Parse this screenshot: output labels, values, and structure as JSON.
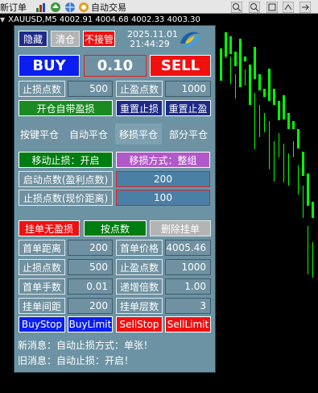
{
  "toolbar": {
    "new_order": "新订单",
    "auto_trading": "自动交易"
  },
  "chart_header": {
    "text": "XAUUSD,M5  4002.91 4004.68 4002.33 4003.30"
  },
  "panel": {
    "hide": "隐藏",
    "clear": "清仓",
    "no_take": "不接管",
    "date": "2025.11.01",
    "time": "21:44:29",
    "buy": "BUY",
    "lot": "0.10",
    "sell": "SELL",
    "sl_label": "止损点数",
    "sl_value": "500",
    "tp_label": "止盈点数",
    "tp_value": "1000",
    "open_with_sltp": "开仓自带盈损",
    "reset_sl": "重置止损",
    "reset_tp": "重置止盈",
    "tabs": [
      "按键平仓",
      "自动平仓",
      "移损平仓",
      "部分平仓"
    ],
    "trailing_stop": "移动止损：开启",
    "trailing_mode": "移损方式：整组",
    "trigger_label": "启动点数(盈利点数)",
    "trigger_value": "200",
    "stop_label": "止损点数(现价距离)",
    "stop_value": "100",
    "pending_no_sltp": "挂单无盈损",
    "by_points": "按点数",
    "delete_pending": "删除挂单",
    "first_distance_label": "首单距离",
    "first_distance_value": "200",
    "first_price_label": "首单价格",
    "first_price_value": "4005.46",
    "p_sl_label": "止损点数",
    "p_sl_value": "500",
    "p_tp_label": "止盈点数",
    "p_tp_value": "1000",
    "first_lot_label": "首单手数",
    "first_lot_value": "0.01",
    "multiplier_label": "递增倍数",
    "multiplier_value": "1.00",
    "interval_label": "挂单间距",
    "interval_value": "200",
    "layers_label": "挂单层数",
    "layers_value": "3",
    "buystop": "BuyStop",
    "buylimit": "BuyLimit",
    "sellstop": "SellStop",
    "selllimit": "SellLimit",
    "new_msg": "新消息：自动止损方式：单张！",
    "old_msg": "旧消息：自动止损：开启！"
  },
  "colors": {
    "panel_bg": "#6c93a3",
    "buy": "#0a1ef0",
    "sell": "#f01010",
    "candle": "#00ff00"
  }
}
